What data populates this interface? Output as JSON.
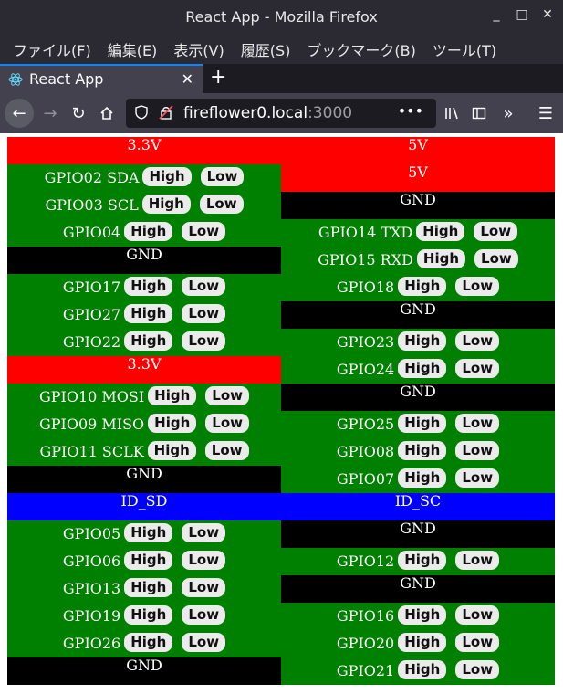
{
  "window": {
    "title": "React App - Mozilla Firefox"
  },
  "menu": [
    "ファイル(F)",
    "編集(E)",
    "表示(V)",
    "履歴(S)",
    "ブックマーク(B)",
    "ツール(T)"
  ],
  "tab": {
    "label": "React App"
  },
  "url": {
    "host": "fireflower0.local",
    "port": ":3000"
  },
  "colors": {
    "power3v3": "#ff0000",
    "power5v": "#ff0000",
    "ground": "#000000",
    "gpio": "#008000",
    "id": "#0000ff"
  },
  "buttons": {
    "high": "High",
    "low": "Low"
  },
  "header": {
    "left": "3.3V",
    "right": "5V"
  },
  "left_pins": [
    {
      "label": "GPIO02 SDA",
      "type": "gpio"
    },
    {
      "label": "GPIO03 SCL",
      "type": "gpio"
    },
    {
      "label": "GPIO04",
      "type": "gpio"
    },
    {
      "label": "GND",
      "type": "ground"
    },
    {
      "label": "GPIO17",
      "type": "gpio"
    },
    {
      "label": "GPIO27",
      "type": "gpio"
    },
    {
      "label": "GPIO22",
      "type": "gpio"
    },
    {
      "label": "3.3V",
      "type": "power3v3"
    },
    {
      "label": "GPIO10 MOSI",
      "type": "gpio"
    },
    {
      "label": "GPIO09 MISO",
      "type": "gpio"
    },
    {
      "label": "GPIO11 SCLK",
      "type": "gpio"
    },
    {
      "label": "GND",
      "type": "ground"
    },
    {
      "label": "ID_SD",
      "type": "id"
    },
    {
      "label": "GPIO05",
      "type": "gpio"
    },
    {
      "label": "GPIO06",
      "type": "gpio"
    },
    {
      "label": "GPIO13",
      "type": "gpio"
    },
    {
      "label": "GPIO19",
      "type": "gpio"
    },
    {
      "label": "GPIO26",
      "type": "gpio"
    },
    {
      "label": "GND",
      "type": "ground"
    }
  ],
  "right_pins": [
    {
      "label": "5V",
      "type": "power5v"
    },
    {
      "label": "GND",
      "type": "ground"
    },
    {
      "label": "GPIO14 TXD",
      "type": "gpio"
    },
    {
      "label": "GPIO15 RXD",
      "type": "gpio"
    },
    {
      "label": "GPIO18",
      "type": "gpio"
    },
    {
      "label": "GND",
      "type": "ground"
    },
    {
      "label": "GPIO23",
      "type": "gpio"
    },
    {
      "label": "GPIO24",
      "type": "gpio"
    },
    {
      "label": "GND",
      "type": "ground"
    },
    {
      "label": "GPIO25",
      "type": "gpio"
    },
    {
      "label": "GPIO08",
      "type": "gpio"
    },
    {
      "label": "GPIO07",
      "type": "gpio"
    },
    {
      "label": "ID_SC",
      "type": "id"
    },
    {
      "label": "GND",
      "type": "ground"
    },
    {
      "label": "GPIO12",
      "type": "gpio"
    },
    {
      "label": "GND",
      "type": "ground"
    },
    {
      "label": "GPIO16",
      "type": "gpio"
    },
    {
      "label": "GPIO20",
      "type": "gpio"
    },
    {
      "label": "GPIO21",
      "type": "gpio"
    }
  ]
}
